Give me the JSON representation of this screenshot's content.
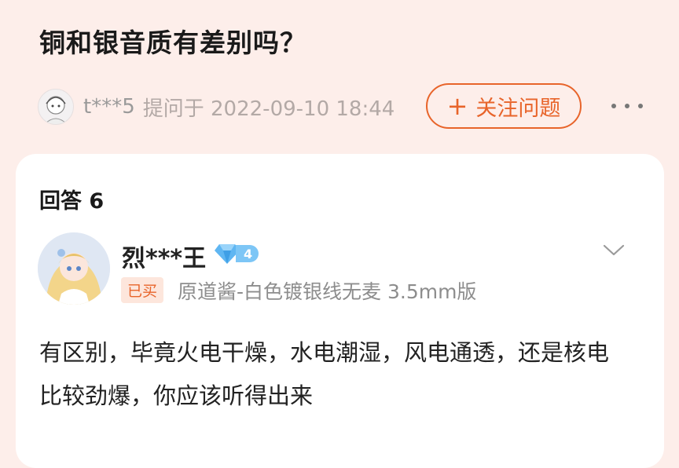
{
  "question": {
    "title": "铜和银音质有差别吗？",
    "asker_name": "t***5",
    "asked_at": "提问于 2022-09-10 18:44",
    "follow_label": "关注问题",
    "follow_icon": "plus-icon",
    "more_icon": "more-dots-icon"
  },
  "answers": {
    "header": "回答 6",
    "items": [
      {
        "username": "烈***王",
        "level": "4",
        "level_icon": "diamond-icon",
        "bought_label": "已买",
        "product": "原道酱-白色镀银线无麦 3.5mm版",
        "text": "有区别，毕竟火电干燥，水电潮湿，风电通透，还是核电比较劲爆，你应该听得出来"
      }
    ]
  },
  "colors": {
    "accent": "#e8642a",
    "page_bg": "#fdeeea",
    "card_bg": "#ffffff",
    "diamond": "#5fb6f2"
  }
}
